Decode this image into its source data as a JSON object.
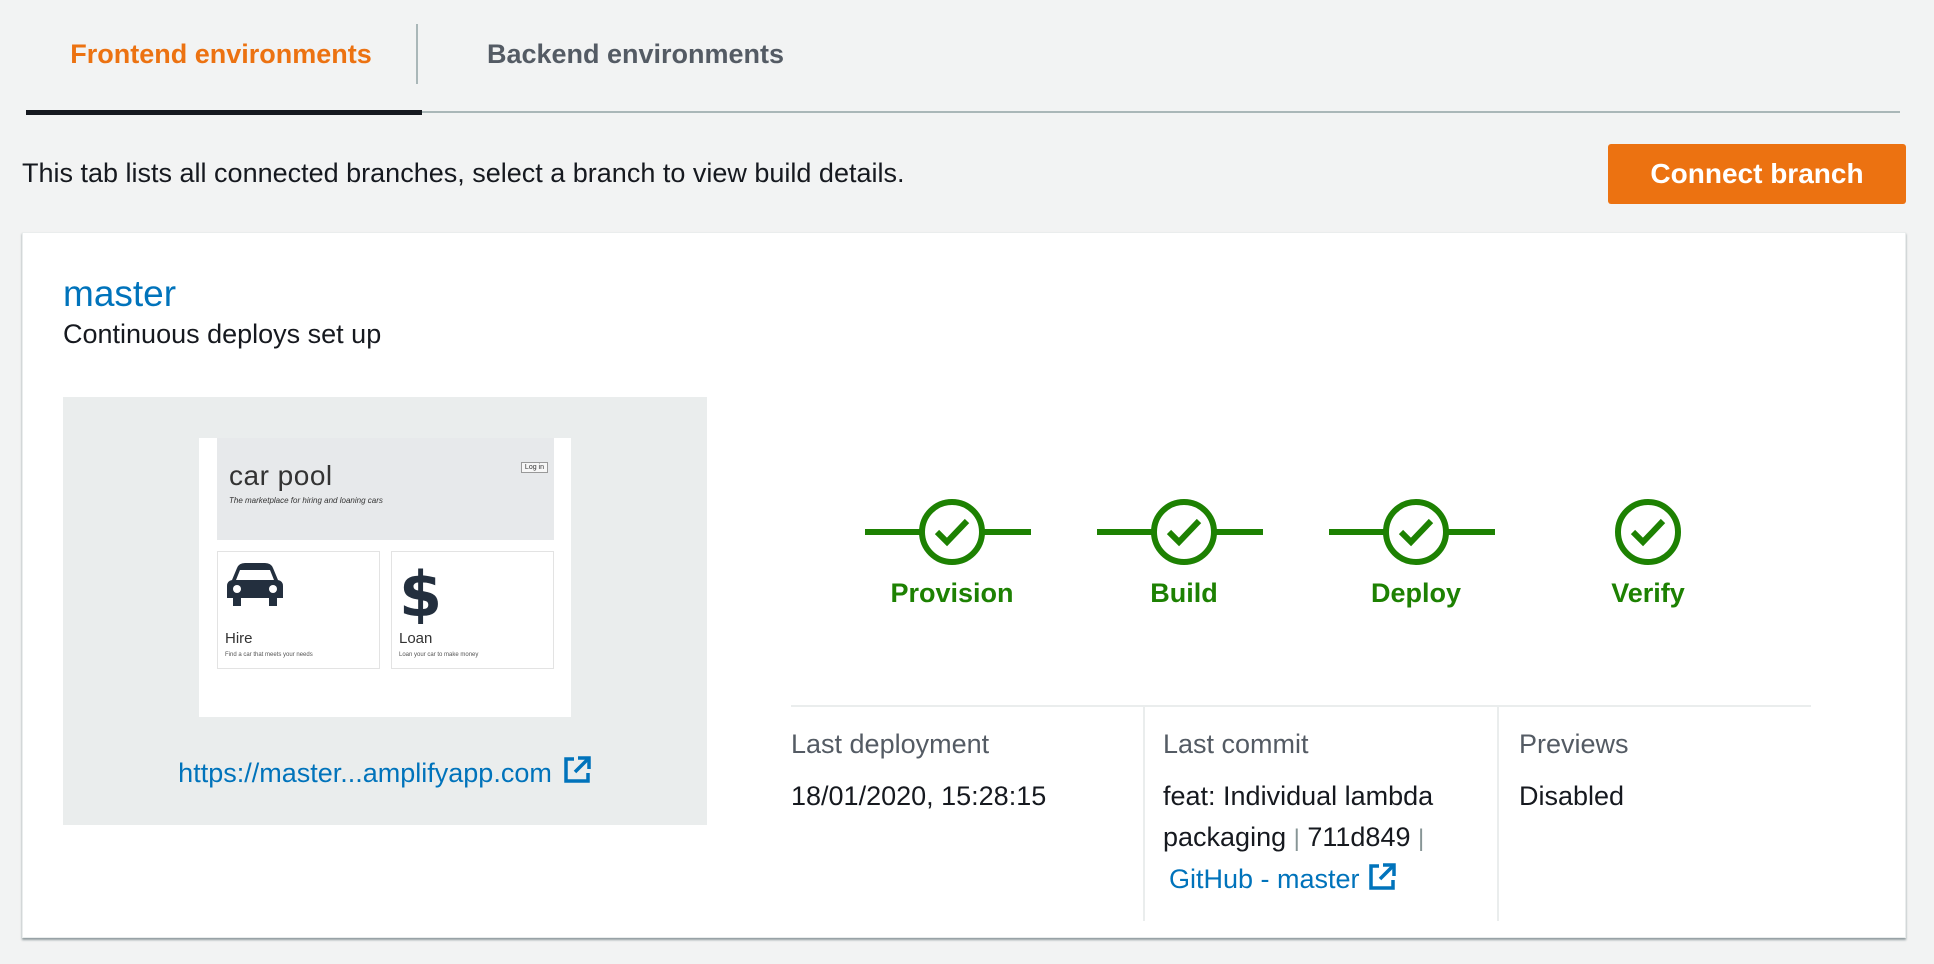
{
  "tabs": [
    {
      "label": "Frontend environments",
      "active": true
    },
    {
      "label": "Backend environments",
      "active": false
    }
  ],
  "intro_text": "This tab lists all connected branches, select a branch to view build details.",
  "connect_button_label": "Connect branch",
  "branch": {
    "name": "master",
    "subtitle": "Continuous deploys set up",
    "preview": {
      "app_title": "car pool",
      "app_tagline": "The marketplace for hiring and loaning cars",
      "login_label": "Log in",
      "cards": [
        {
          "label": "Hire",
          "desc": "Find a car that meets your needs",
          "icon": "car-icon"
        },
        {
          "label": "Loan",
          "desc": "Loan your car to make money",
          "icon": "dollar-icon"
        }
      ],
      "url_label": "https://master...amplifyapp.com"
    },
    "stages": [
      {
        "label": "Provision",
        "status": "complete"
      },
      {
        "label": "Build",
        "status": "complete"
      },
      {
        "label": "Deploy",
        "status": "complete"
      },
      {
        "label": "Verify",
        "status": "complete"
      }
    ],
    "last_deployment": {
      "label": "Last deployment",
      "value": "18/01/2020, 15:28:15"
    },
    "last_commit": {
      "label": "Last commit",
      "message": "feat: Individual lambda packaging",
      "separator": "|",
      "hash": "711d849",
      "repo_link": "GitHub - master"
    },
    "previews": {
      "label": "Previews",
      "value": "Disabled"
    }
  },
  "colors": {
    "accent": "#ec7211",
    "link": "#0073bb",
    "success": "#1d8102",
    "background": "#f2f3f3"
  }
}
